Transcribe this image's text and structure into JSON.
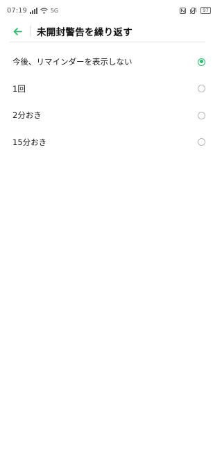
{
  "status_bar": {
    "time": "07:19",
    "network_label": "5G",
    "battery": "97"
  },
  "header": {
    "title": "未開封警告を繰り返す"
  },
  "options": [
    {
      "label": "今後、リマインダーを表示しない",
      "selected": true
    },
    {
      "label": "1回",
      "selected": false
    },
    {
      "label": "2分おき",
      "selected": false
    },
    {
      "label": "15分おき",
      "selected": false
    }
  ],
  "colors": {
    "accent": "#2bbd6e"
  }
}
